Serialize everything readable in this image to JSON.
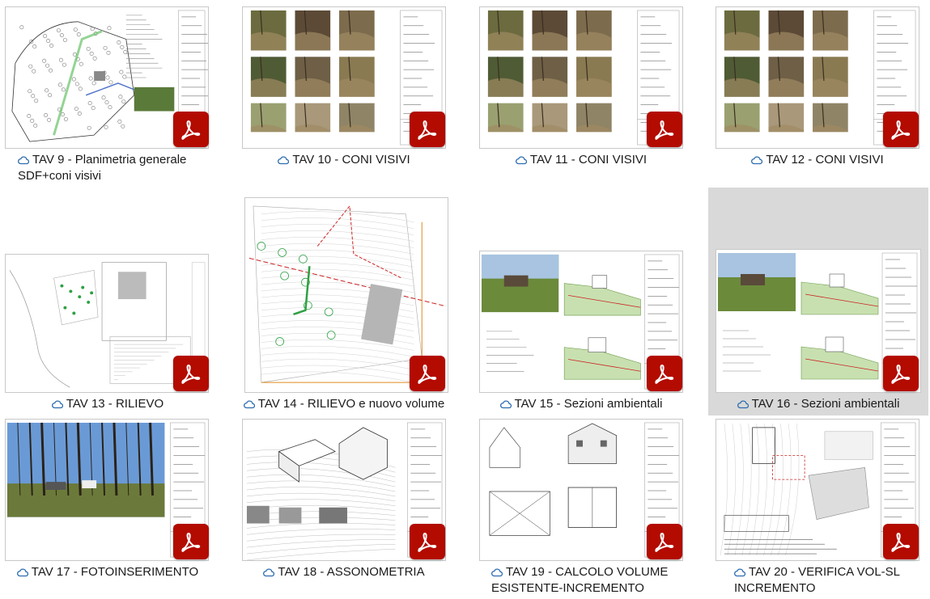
{
  "colors": {
    "pdf_badge": "#b30b00",
    "cloud_icon": "#2b6cb0",
    "selected_bg": "#d9d9d9"
  },
  "files": [
    {
      "name": "TAV 9 - Planimetria generale",
      "name2": "SDF+coni visivi",
      "kind": "plan",
      "selected": false
    },
    {
      "name": "TAV 10 - CONI VISIVI",
      "kind": "photos",
      "selected": false
    },
    {
      "name": "TAV 11 - CONI VISIVI",
      "kind": "photos",
      "selected": false
    },
    {
      "name": "TAV 12 - CONI VISIVI",
      "kind": "photos",
      "selected": false
    },
    {
      "name": "TAV 13 - RILIEVO",
      "kind": "survey",
      "selected": false
    },
    {
      "name": "TAV 14 - RILIEVO e nuovo volume",
      "kind": "survey2",
      "selected": false
    },
    {
      "name": "TAV 15 - Sezioni ambientali",
      "kind": "sections",
      "selected": false
    },
    {
      "name": "TAV 16 - Sezioni ambientali",
      "kind": "sections",
      "selected": true
    },
    {
      "name": "TAV 17 - FOTOINSERIMENTO",
      "kind": "photo",
      "selected": false
    },
    {
      "name": "TAV 18 - ASSONOMETRIA",
      "kind": "axo",
      "selected": false
    },
    {
      "name": "TAV 19 - CALCOLO VOLUME",
      "name2": "ESISTENTE-INCREMENTO",
      "kind": "volume",
      "selected": false
    },
    {
      "name": "TAV 20 - VERIFICA VOL-SL",
      "name2": "INCREMENTO",
      "kind": "plan2",
      "selected": false
    }
  ]
}
